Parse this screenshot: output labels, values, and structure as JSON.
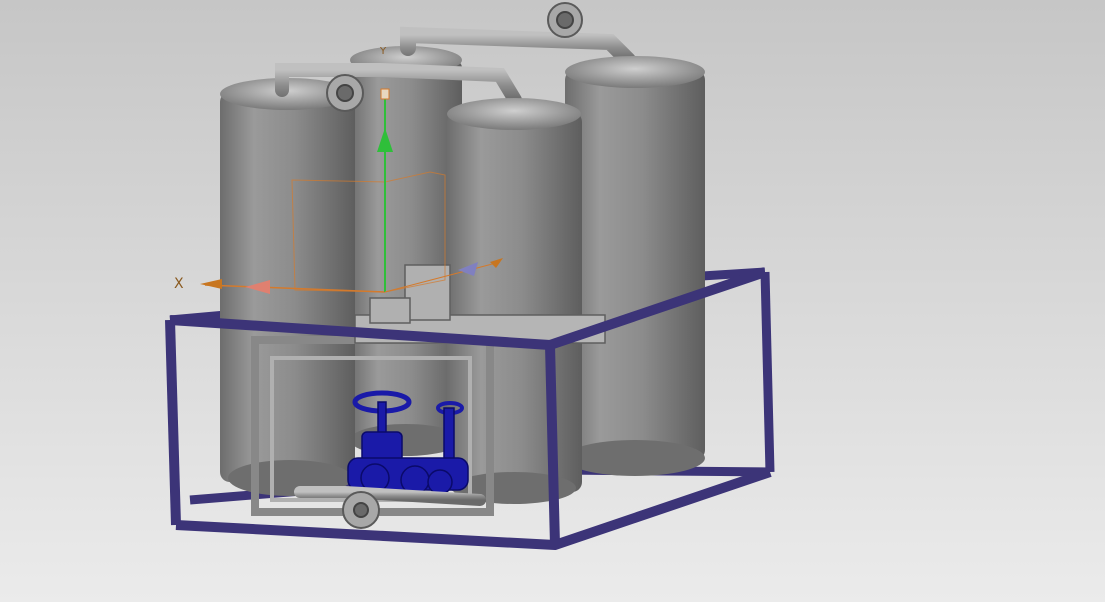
{
  "viewport": {
    "background_top": "#c9c9c9",
    "background_bottom": "#e9e9e9"
  },
  "model": {
    "vessel_color": "#8a8a8a",
    "frame_color": "#3c3478",
    "valve_color": "#1a1aa8",
    "pipe_color": "#9a9a9a",
    "vessel_count": 4,
    "valve_count": 4
  },
  "manipulator": {
    "x_label": "X",
    "y_label": "Y",
    "x_axis_color": "#d47a2c",
    "y_axis_color": "#2fbf3a",
    "z_axis_color": "#8080c0",
    "box_color": "#d47a2c"
  }
}
